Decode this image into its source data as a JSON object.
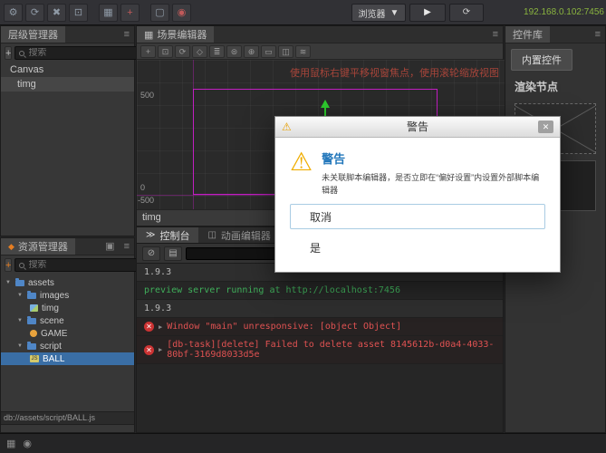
{
  "toolbar": {
    "icons": [
      "⚙",
      "⟳",
      "✖",
      "⊡",
      "▦",
      "+",
      "▢",
      "◉"
    ],
    "browser_label": "浏览器",
    "browser_caret": "▼",
    "play_glyph": "▶",
    "refresh_glyph": "⟳",
    "ip": "192.168.0.102:7456"
  },
  "glyphs": {
    "menu": "≡",
    "pencil": "✎",
    "copy": "▣",
    "clear": "⊘",
    "list": "▤",
    "caret_down": "▾",
    "caret_open": "▼",
    "expand": "▶",
    "close": "✕",
    "warning": "⚠",
    "error": "✕",
    "console_tab": "≫",
    "anim_tab": "◫",
    "grid": "▦",
    "eye": "◉",
    "fire": "◆",
    "js": "JS"
  },
  "hierarchy": {
    "title": "层级管理器",
    "add_glyph": "+",
    "search_placeholder": "搜索",
    "items": [
      {
        "label": "Canvas"
      },
      {
        "label": "timg"
      }
    ]
  },
  "assets": {
    "title": "资源管理器",
    "add_glyph": "+",
    "search_placeholder": "搜索",
    "tree": [
      {
        "label": "assets"
      },
      {
        "label": "images"
      },
      {
        "label": "timg"
      },
      {
        "label": "scene"
      },
      {
        "label": "GAME"
      },
      {
        "label": "script"
      },
      {
        "label": "BALL"
      }
    ],
    "path": "db://assets/script/BALL.js"
  },
  "scene": {
    "title": "场景编辑器",
    "tools": [
      "+",
      "⊡",
      "⟳",
      "◇",
      "≣",
      "⊜",
      "⊕",
      "▭",
      "◫",
      "≋"
    ],
    "hint": "使用鼠标右键平移视窗焦点，使用滚轮缩放视图",
    "ruler": {
      "top": "500",
      "left_zero": "0",
      "bottom_left": "-500",
      "bottom_center": "0"
    },
    "bottom_label": "timg"
  },
  "console": {
    "tab_console": "控制台",
    "tab_animation": "动画编辑器",
    "logs": [
      {
        "text": "1.9.3"
      },
      {
        "text": "preview server running at http://localhost:7456"
      },
      {
        "text": "1.9.3"
      },
      {
        "text": "Window \"main\" unresponsive: [object Object]"
      },
      {
        "text": "[db-task][delete] Failed to delete asset 8145612b-d0a4-4033-80bf-3169d8033d5e"
      }
    ]
  },
  "widgets": {
    "title": "控件库",
    "tab_builtin": "内置控件",
    "section_render": "渲染节点"
  },
  "dialog": {
    "title": "警告",
    "heading": "警告",
    "message": "未关联脚本编辑器，是否立即在“偏好设置”内设置外部脚本编辑器",
    "cancel_label": "取消",
    "confirm_label": "是"
  },
  "statusbar": {
    "icons": [
      "▦",
      "◉"
    ]
  }
}
